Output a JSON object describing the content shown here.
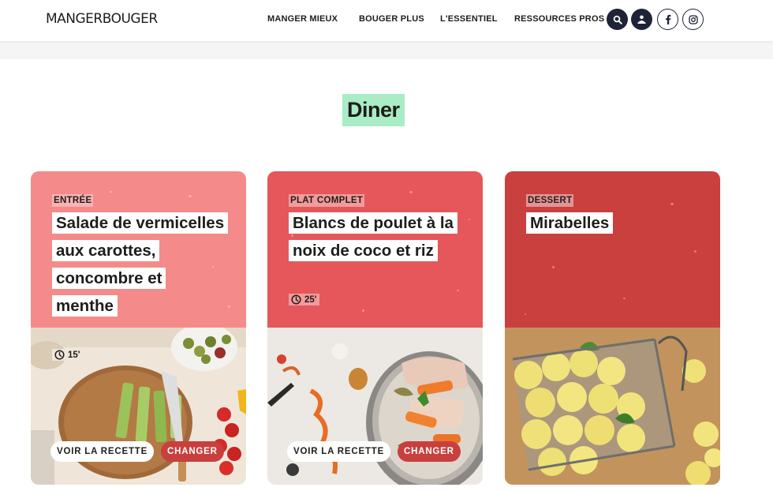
{
  "header": {
    "logo": "MANGERBOUGER",
    "nav": [
      "MANGER MIEUX",
      "BOUGER PLUS",
      "L'ESSENTIEL",
      "RESSOURCES PROS"
    ],
    "icons": [
      "search-icon",
      "user-icon",
      "facebook-icon",
      "instagram-icon"
    ]
  },
  "section": {
    "title": "Diner"
  },
  "cards": [
    {
      "category": "ENTRÉE",
      "title": "Salade de vermicelles aux carottes, concombre et menthe",
      "time": "15'",
      "top_color": "#f58a8a",
      "category_bg": "#f8b3b3",
      "image": "salad-preparation-photo"
    },
    {
      "category": "PLAT COMPLET",
      "title": "Blancs de poulet à la noix de coco et riz",
      "time": "25'",
      "top_color": "#e5575a",
      "category_bg": "#f29b9b",
      "image": "chicken-pot-photo"
    },
    {
      "category": "DESSERT",
      "title": "Mirabelles",
      "time": "",
      "top_color": "#c9403f",
      "category_bg": "#e49494",
      "image": "mirabelle-plums-basket-photo"
    }
  ],
  "buttons": {
    "voir": "VOIR LA RECETTE",
    "changer": "CHANGER"
  },
  "colors": {
    "title_highlight": "#a9ecc5",
    "dark": "#1f2337",
    "changer_bg": "#c7403d"
  }
}
